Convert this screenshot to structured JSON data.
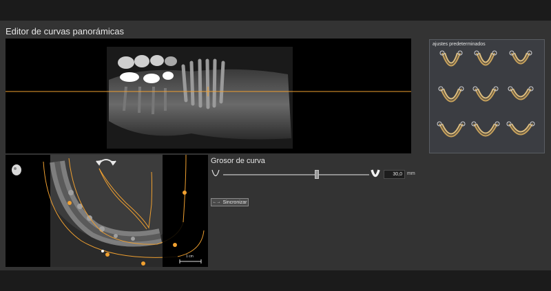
{
  "window": {
    "title": "Editor de curvas panorámicas"
  },
  "presets": {
    "title": "ajustes predeterminados",
    "items": [
      {
        "name": "preset-1"
      },
      {
        "name": "preset-2"
      },
      {
        "name": "preset-3"
      },
      {
        "name": "preset-4"
      },
      {
        "name": "preset-5"
      },
      {
        "name": "preset-6"
      },
      {
        "name": "preset-7"
      },
      {
        "name": "preset-8"
      },
      {
        "name": "preset-9"
      }
    ]
  },
  "curve_thickness": {
    "label": "Grosor de curva",
    "value": "30,0",
    "unit": "mm",
    "slider_fraction": 0.64
  },
  "sync": {
    "label": "Sincronizar",
    "icon": "sync-arrows-icon"
  },
  "axial_view": {
    "scale_label": "1 cm"
  },
  "colors": {
    "accent": "#f0a030",
    "panel": "#333333",
    "background": "#1b1b1b"
  }
}
